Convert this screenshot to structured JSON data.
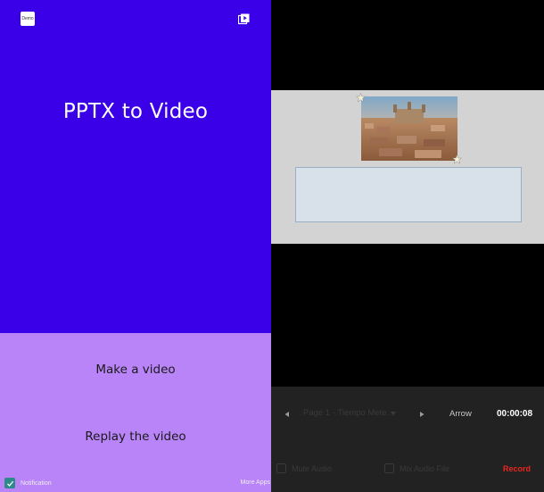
{
  "left_panel": {
    "demo_badge": "Demo",
    "title": "PPTX to Video",
    "make_video_label": "Make a video",
    "replay_video_label": "Replay the video",
    "notification_label": "Notification",
    "notification_checked": true,
    "more_apps_label": "More Apps",
    "colors": {
      "top": "#3a01e8",
      "bottom": "#b984f8",
      "check": "#2e8a8a"
    }
  },
  "right_panel": {
    "controls": {
      "page_select_value": "Page 1 - Tiempo Meteor...",
      "tool_select_value": "Arrow",
      "timer": "00:00:08",
      "mute_audio_label": "Mute Audio",
      "mix_audio_label": "Mix Audio File",
      "record_label": "Record",
      "record_color": "#e8261f"
    },
    "slide": {
      "image_icon": "city-photo",
      "marker_icon": "star-icon",
      "textbox_text": ""
    }
  }
}
